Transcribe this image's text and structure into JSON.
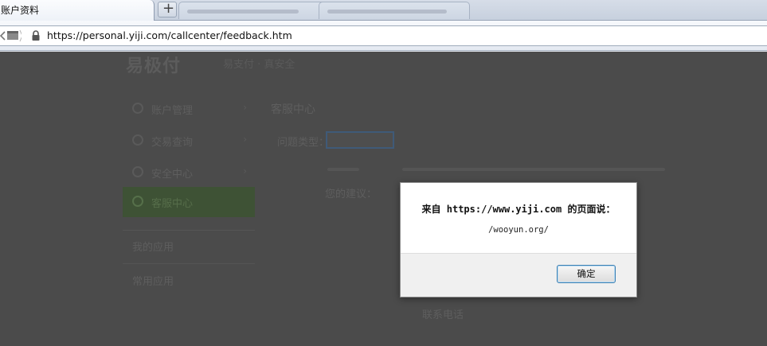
{
  "browser": {
    "active_tab_title": "账户资料",
    "new_tab_label": "+",
    "url": "https://personal.yiji.com/callcenter/feedback.htm"
  },
  "page": {
    "logo": "易极付",
    "slogan": "易支付 · 真安全",
    "sidebar": [
      {
        "label": "账户管理",
        "arrow": "›"
      },
      {
        "label": "交易查询",
        "arrow": "›"
      },
      {
        "label": "安全中心",
        "arrow": "›"
      },
      {
        "label": "客服中心",
        "arrow": ""
      }
    ],
    "my_apps": "我的应用",
    "common_apps": "常用应用",
    "section_title": "客服中心",
    "question_type_label": "问题类型：",
    "contact_label": "联系电话",
    "extra_label": "您的建议："
  },
  "dialog": {
    "title": "来自 https://www.yiji.com 的页面说：",
    "message": "/wooyun.org/",
    "ok_label": "确定"
  },
  "colors": {
    "overlay": "#4b4b4b",
    "dialog_bg": "#ffffff",
    "button_border": "#3c7fb1"
  }
}
